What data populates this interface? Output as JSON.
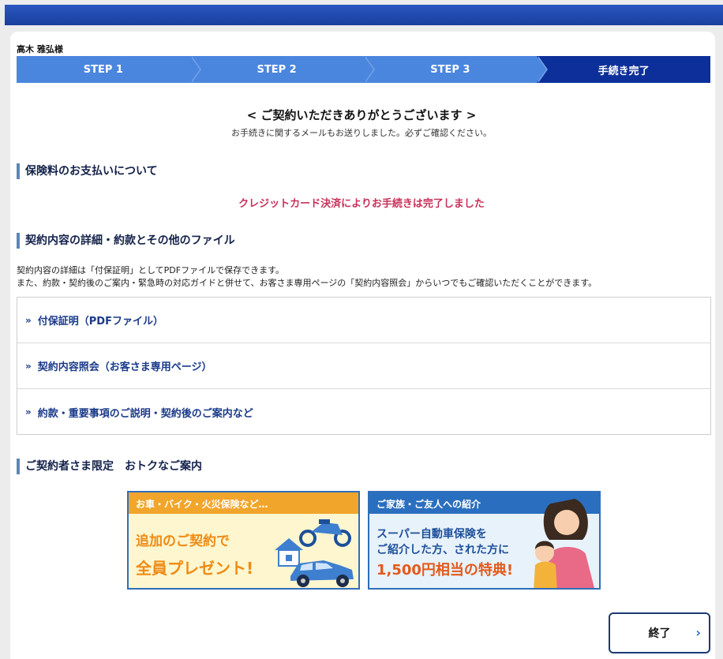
{
  "user": {
    "name": "高木 雅弘様"
  },
  "steps": [
    {
      "label": "STEP 1"
    },
    {
      "label": "STEP 2"
    },
    {
      "label": "STEP 3"
    },
    {
      "label": "手続き完了"
    }
  ],
  "thanks": {
    "title": "< ご契約いただきありがとうございます >",
    "subtitle": "お手続きに関するメールもお送りしました。必ずご確認ください。"
  },
  "payment": {
    "heading": "保険料のお支払いについて",
    "message": "クレジットカード決済によりお手続きは完了しました"
  },
  "documents": {
    "heading": "契約内容の詳細・約款とその他のファイル",
    "desc_line1": "契約内容の詳細は「付保証明」としてPDFファイルで保存できます。",
    "desc_line2": "また、約款・契約後のご案内・緊急時の対応ガイドと併せて、お客さま専用ページの「契約内容照会」からいつでもご確認いただくことができます。",
    "links": [
      {
        "mark": "»",
        "label": "付保証明（PDFファイル）"
      },
      {
        "mark": "»",
        "label": "契約内容照会（お客さま専用ページ）"
      },
      {
        "mark": "»",
        "label": "約款・重要事項のご説明・契約後のご案内など"
      }
    ]
  },
  "offers": {
    "heading": "ご契約者さま限定　おトクなご案内",
    "banner1": {
      "header": "お車・バイク・火災保険など…",
      "line1": "追加のご契約で",
      "line2": "全員プレゼント!"
    },
    "banner2": {
      "header": "ご家族・ご友人への紹介",
      "line1": "スーパー自動車保険を",
      "line2": "ご紹介した方、された方に",
      "line3": "1,500円相当の特典!"
    }
  },
  "footer": {
    "end_label": "終了"
  },
  "colors": {
    "accent": "#4a86de",
    "dark": "#0d2f99",
    "notice": "#c8315a"
  }
}
